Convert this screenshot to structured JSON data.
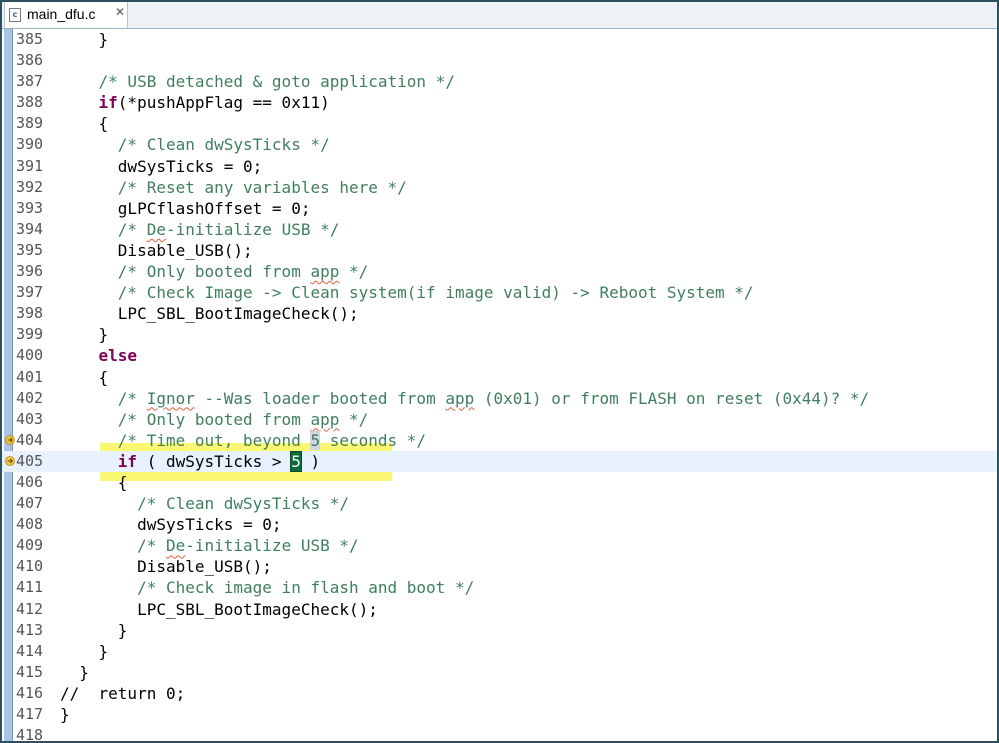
{
  "tab": {
    "filename": "main_dfu.c"
  },
  "code_lines": [
    {
      "num": "385",
      "segs": [
        {
          "t": "    }",
          "k": "n"
        }
      ]
    },
    {
      "num": "386",
      "segs": []
    },
    {
      "num": "387",
      "segs": [
        {
          "t": "    ",
          "k": "n"
        },
        {
          "t": "/* USB detached & goto application */",
          "k": "c"
        }
      ]
    },
    {
      "num": "388",
      "segs": [
        {
          "t": "    ",
          "k": "n"
        },
        {
          "t": "if",
          "k": "k"
        },
        {
          "t": "(*pushAppFlag == 0x11)",
          "k": "n"
        }
      ]
    },
    {
      "num": "389",
      "segs": [
        {
          "t": "    {",
          "k": "n"
        }
      ]
    },
    {
      "num": "390",
      "segs": [
        {
          "t": "      ",
          "k": "n"
        },
        {
          "t": "/* Clean dwSysTicks */",
          "k": "c"
        }
      ]
    },
    {
      "num": "391",
      "segs": [
        {
          "t": "      dwSysTicks = 0;",
          "k": "n"
        }
      ]
    },
    {
      "num": "392",
      "segs": [
        {
          "t": "      ",
          "k": "n"
        },
        {
          "t": "/* Reset any variables here */",
          "k": "c"
        }
      ]
    },
    {
      "num": "393",
      "segs": [
        {
          "t": "      gLPCflashOffset = 0;",
          "k": "n"
        }
      ]
    },
    {
      "num": "394",
      "segs": [
        {
          "t": "      ",
          "k": "n"
        },
        {
          "t": "/* ",
          "k": "c"
        },
        {
          "t": "De",
          "k": "cs"
        },
        {
          "t": "-initialize USB */",
          "k": "c"
        }
      ]
    },
    {
      "num": "395",
      "segs": [
        {
          "t": "      Disable_USB();",
          "k": "n"
        }
      ]
    },
    {
      "num": "396",
      "segs": [
        {
          "t": "      ",
          "k": "n"
        },
        {
          "t": "/* Only booted from ",
          "k": "c"
        },
        {
          "t": "app",
          "k": "cs"
        },
        {
          "t": " */",
          "k": "c"
        }
      ]
    },
    {
      "num": "397",
      "segs": [
        {
          "t": "      ",
          "k": "n"
        },
        {
          "t": "/* Check Image -> Clean system(if image valid) -> Reboot System */",
          "k": "c"
        }
      ]
    },
    {
      "num": "398",
      "segs": [
        {
          "t": "      LPC_SBL_BootImageCheck();",
          "k": "n"
        }
      ]
    },
    {
      "num": "399",
      "segs": [
        {
          "t": "    }",
          "k": "n"
        }
      ]
    },
    {
      "num": "400",
      "segs": [
        {
          "t": "    ",
          "k": "n"
        },
        {
          "t": "else",
          "k": "k"
        }
      ]
    },
    {
      "num": "401",
      "segs": [
        {
          "t": "    {",
          "k": "n"
        }
      ]
    },
    {
      "num": "402",
      "segs": [
        {
          "t": "      ",
          "k": "n"
        },
        {
          "t": "/* ",
          "k": "c"
        },
        {
          "t": "Ignor",
          "k": "cs"
        },
        {
          "t": " --Was loader booted from ",
          "k": "c"
        },
        {
          "t": "app",
          "k": "cs"
        },
        {
          "t": " (0x01) or from FLASH on reset (0x44)? */",
          "k": "c"
        }
      ]
    },
    {
      "num": "403",
      "segs": [
        {
          "t": "      ",
          "k": "n"
        },
        {
          "t": "/* Only booted from ",
          "k": "c"
        },
        {
          "t": "app",
          "k": "cs"
        },
        {
          "t": " */",
          "k": "c"
        }
      ]
    },
    {
      "num": "404",
      "marker": true,
      "segs": [
        {
          "t": "      ",
          "k": "n"
        },
        {
          "t": "/* Time out, beyond ",
          "k": "c"
        },
        {
          "t": "5",
          "k": "co"
        },
        {
          "t": " seconds */",
          "k": "c"
        }
      ]
    },
    {
      "num": "405",
      "marker": true,
      "current": true,
      "segs": [
        {
          "t": "      ",
          "k": "n"
        },
        {
          "t": "if",
          "k": "k"
        },
        {
          "t": " ( dwSysTicks > ",
          "k": "n"
        },
        {
          "t": "5",
          "k": "cur"
        },
        {
          "t": " )",
          "k": "n"
        }
      ]
    },
    {
      "num": "406",
      "segs": [
        {
          "t": "      {",
          "k": "n"
        }
      ]
    },
    {
      "num": "407",
      "segs": [
        {
          "t": "        ",
          "k": "n"
        },
        {
          "t": "/* Clean dwSysTicks */",
          "k": "c"
        }
      ]
    },
    {
      "num": "408",
      "segs": [
        {
          "t": "        dwSysTicks = 0;",
          "k": "n"
        }
      ]
    },
    {
      "num": "409",
      "segs": [
        {
          "t": "        ",
          "k": "n"
        },
        {
          "t": "/* ",
          "k": "c"
        },
        {
          "t": "De",
          "k": "cs"
        },
        {
          "t": "-initialize USB */",
          "k": "c"
        }
      ]
    },
    {
      "num": "410",
      "segs": [
        {
          "t": "        Disable_USB();",
          "k": "n"
        }
      ]
    },
    {
      "num": "411",
      "segs": [
        {
          "t": "        ",
          "k": "n"
        },
        {
          "t": "/* Check image in flash and boot */",
          "k": "c"
        }
      ]
    },
    {
      "num": "412",
      "segs": [
        {
          "t": "        LPC_SBL_BootImageCheck();",
          "k": "n"
        }
      ]
    },
    {
      "num": "413",
      "segs": [
        {
          "t": "      }",
          "k": "n"
        }
      ]
    },
    {
      "num": "414",
      "segs": [
        {
          "t": "    }",
          "k": "n"
        }
      ]
    },
    {
      "num": "415",
      "segs": [
        {
          "t": "  }",
          "k": "n"
        }
      ]
    },
    {
      "num": "416",
      "segs": [
        {
          "t": "//  return 0;",
          "k": "n"
        }
      ]
    },
    {
      "num": "417",
      "segs": [
        {
          "t": "}",
          "k": "n"
        }
      ]
    },
    {
      "num": "418",
      "segs": []
    }
  ]
}
